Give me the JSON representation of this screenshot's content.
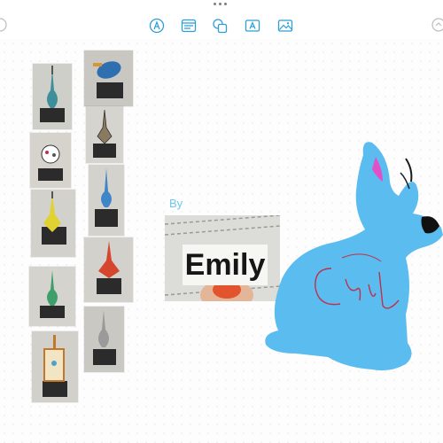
{
  "toolbar": {
    "tools": [
      {
        "name": "pen-tool-icon"
      },
      {
        "name": "text-block-icon"
      },
      {
        "name": "shapes-icon"
      },
      {
        "name": "text-box-icon"
      },
      {
        "name": "media-icon"
      }
    ],
    "accent_color": "#2e9ed7"
  },
  "board": {
    "byline": "By",
    "photo_label": "Emily",
    "rabbit_color": "#5bbcf0",
    "scribble_color": "#c0304a"
  },
  "gallery": {
    "cards": [
      {
        "name": "guitar-card-1"
      },
      {
        "name": "guitar-card-2"
      },
      {
        "name": "guitar-card-3"
      },
      {
        "name": "guitar-card-4"
      },
      {
        "name": "guitar-card-5"
      },
      {
        "name": "guitar-card-6"
      },
      {
        "name": "guitar-card-7"
      },
      {
        "name": "guitar-card-8"
      },
      {
        "name": "guitar-card-9"
      },
      {
        "name": "guitar-card-10"
      }
    ]
  }
}
